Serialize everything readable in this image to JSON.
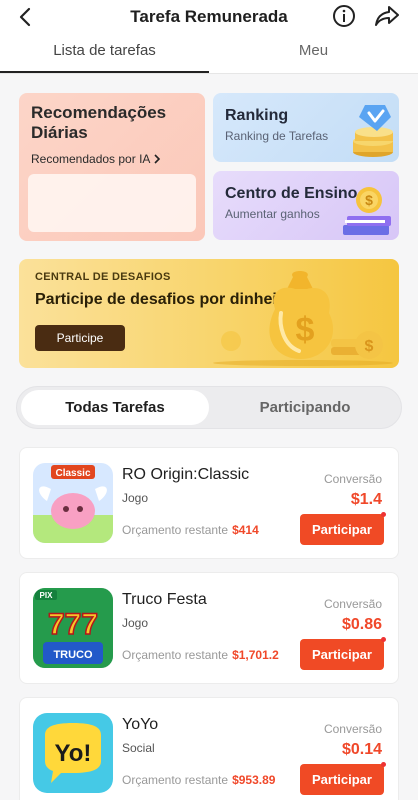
{
  "header": {
    "title": "Tarefa Remunerada"
  },
  "tabs": [
    {
      "label": "Lista de tarefas"
    },
    {
      "label": "Meu"
    }
  ],
  "cards": {
    "recommendations": {
      "title": "Recomendações Diárias",
      "subtitle": "Recomendados por IA"
    },
    "ranking": {
      "title": "Ranking",
      "subtitle": "Ranking de Tarefas"
    },
    "teaching": {
      "title": "Centro de Ensino",
      "subtitle": "Aumentar ganhos"
    }
  },
  "banner": {
    "kicker": "CENTRAL DE DESAFIOS",
    "headline": "Participe de desafios por dinheiro !",
    "button": "Participe"
  },
  "segment": {
    "all": "Todas Tarefas",
    "participating": "Participando"
  },
  "tasks": [
    {
      "name": "RO Origin:Classic",
      "category": "Jogo",
      "budget_label": "Orçamento restante",
      "budget": "$414",
      "conversion_label": "Conversão",
      "price": "$1.4",
      "button": "Participar",
      "badge": "Classic"
    },
    {
      "name": "Truco Festa",
      "category": "Jogo",
      "budget_label": "Orçamento restante",
      "budget": "$1,701.2",
      "conversion_label": "Conversão",
      "price": "$0.86",
      "button": "Participar",
      "badge": "PIX"
    },
    {
      "name": "YoYo",
      "category": "Social",
      "budget_label": "Orçamento restante",
      "budget": "$953.89",
      "conversion_label": "Conversão",
      "price": "$0.14",
      "button": "Participar",
      "badge": "Yo!"
    }
  ]
}
